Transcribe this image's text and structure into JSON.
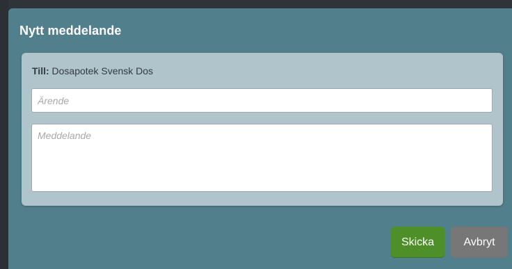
{
  "modal": {
    "title": "Nytt meddelande"
  },
  "recipient": {
    "label": "Till:",
    "value": "Dosapotek Svensk Dos"
  },
  "subject": {
    "placeholder": "Ärende",
    "value": ""
  },
  "message": {
    "placeholder": "Meddelande",
    "value": ""
  },
  "buttons": {
    "send_label": "Skicka",
    "cancel_label": "Avbryt"
  },
  "colors": {
    "modal_bg": "#527f8c",
    "panel_bg": "#b0c4cb",
    "send_button": "#4f8f2a",
    "cancel_button": "#777777"
  }
}
